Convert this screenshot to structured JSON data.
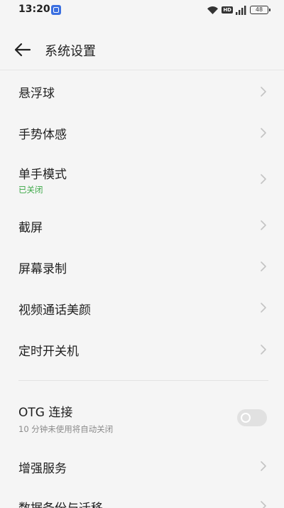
{
  "status_bar": {
    "time": "13:20",
    "hd": "HD",
    "battery": "48",
    "icons": [
      "app-notification-icon",
      "wifi-icon",
      "signal-icon",
      "battery-icon"
    ]
  },
  "header": {
    "title": "系统设置",
    "back_icon": "arrow-left-icon"
  },
  "colors": {
    "accent_green": "#3aa845",
    "background": "#f5f5f5",
    "text_primary": "#1f1f1f",
    "text_secondary": "#8a8a8a"
  },
  "settings": {
    "items": [
      {
        "label": "悬浮球"
      },
      {
        "label": "手势体感"
      },
      {
        "label": "单手模式",
        "status": "已关闭"
      },
      {
        "label": "截屏"
      },
      {
        "label": "屏幕录制"
      },
      {
        "label": "视频通话美颜"
      },
      {
        "label": "定时开关机"
      }
    ],
    "otg": {
      "label": "OTG 连接",
      "subtitle": "10 分钟未使用将自动关闭",
      "enabled": false
    },
    "items2": [
      {
        "label": "增强服务"
      },
      {
        "label": "数据备份与迁移"
      }
    ]
  }
}
